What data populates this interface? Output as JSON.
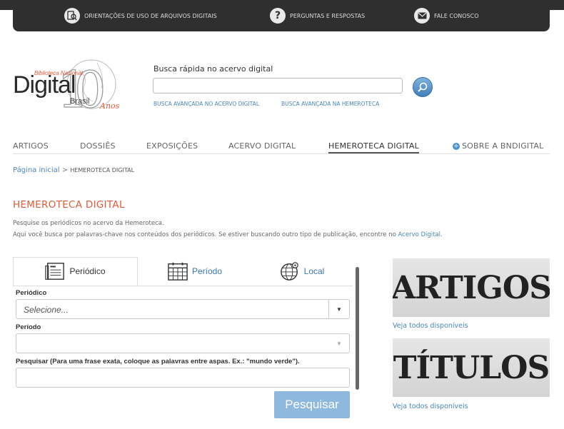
{
  "top_links": [
    {
      "label": "ORIENTAÇÕES DE USO DE ARQUIVOS DIGITAIS",
      "icon": "search-document-icon"
    },
    {
      "label": "PERGUNTAS E RESPOSTAS",
      "icon": "question-icon"
    },
    {
      "label": "FALE CONOSCO",
      "icon": "mail-icon"
    }
  ],
  "logo": {
    "line1": "Biblioteca Nacional",
    "line2": "Digital",
    "line3": "Brasil",
    "anos": "Anos",
    "number": "10"
  },
  "search": {
    "label": "Busca rápida no acervo digital",
    "placeholder": "",
    "adv_acervo": "BUSCA AVANÇADA NO ACERVO DIGITAL",
    "adv_hemeroteca": "BUSCA AVANÇADA NA HEMEROTECA"
  },
  "nav": {
    "items": [
      "ARTIGOS",
      "DOSSIÊS",
      "EXPOSIÇÕES",
      "ACERVO DIGITAL",
      "HEMEROTECA DIGITAL"
    ],
    "about": "SOBRE A BNDIGITAL",
    "active": "HEMEROTECA DIGITAL"
  },
  "breadcrumb": {
    "home": "Página inicial",
    "separator": ">",
    "current": "HEMEROTECA DIGITAL"
  },
  "page": {
    "title": "HEMEROTECA DIGITAL",
    "desc1": "Pesquise os periódicos no acervo da Hemeroteca.",
    "desc2": "Aqui você busca por palavras-chave nos conteúdos dos periódicos. Se estiver buscando outro tipo de publicação, encontre no",
    "desc2_link": "Acervo Digital",
    "desc2_end": "."
  },
  "tabs": [
    {
      "label": "Periódico",
      "active": true
    },
    {
      "label": "Período",
      "active": false
    },
    {
      "label": "Local",
      "active": false
    }
  ],
  "form": {
    "periodico_label": "Periódico",
    "periodico_value": "Selecione...",
    "periodo_label": "Período",
    "periodo_value": "",
    "pesquisar_label": "Pesquisar (Para uma frase exata, coloque as palavras entre aspas. Ex.: \"mundo verde\").",
    "pesquisar_value": "",
    "submit": "Pesquisar"
  },
  "sidebar": {
    "banner1": "ARTIGOS",
    "banner1_link": "Veja todos disponíveis",
    "banner2": "TÍTULOS",
    "banner2_link": "Veja todos disponíveis"
  },
  "colors": {
    "accent": "#e05a3a",
    "link": "#4a86b8",
    "topbar": "#2f2f2f"
  }
}
